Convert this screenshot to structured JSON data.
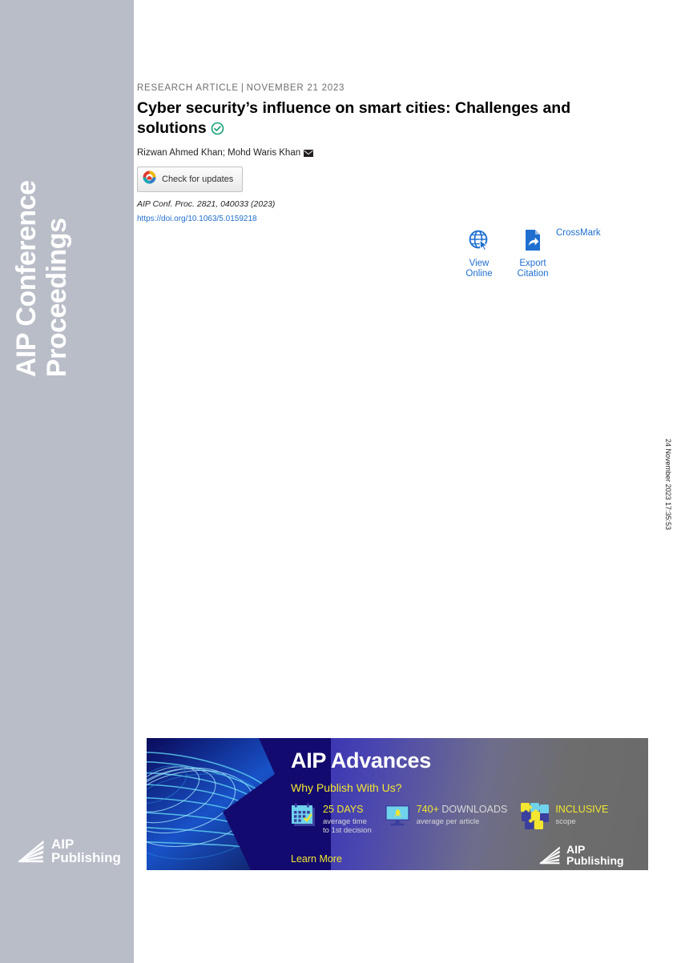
{
  "sidebar": {
    "journal_name": "AIP Conference\nProceedings",
    "publisher_logo": {
      "icon": "aip-fan-logo-icon",
      "line1": "AIP",
      "line2": "Publishing"
    },
    "background_color": "#b9bdc8"
  },
  "margin": {
    "timestamp": "24 November 2023 17:35:53"
  },
  "article": {
    "kicker": {
      "type": "RESEARCH ARTICLE",
      "separator": "|",
      "date": "NOVEMBER 21 2023"
    },
    "title": "Cyber security’s influence on smart cities: Challenges and solutions",
    "open_access_icon": "circle-check-icon",
    "authors": "Rizwan Ahmed Khan; Mohd Waris Khan",
    "corresponding_author_icon": "envelope-icon",
    "crossmark_badge": {
      "icon": "crossmark-logo-icon",
      "label": "Check for updates"
    },
    "citation": "AIP Conf. Proc. 2821, 040033 (2023)",
    "doi_url": "https://doi.org/10.1063/5.0159218",
    "link_color": "#1f6fd0"
  },
  "actions": {
    "items": [
      {
        "icon": "globe-cursor-icon",
        "label": "View\nOnline"
      },
      {
        "icon": "document-share-icon",
        "label": "Export\nCitation"
      }
    ],
    "crossmark_label": "CrossMark"
  },
  "banner": {
    "title": "AIP Advances",
    "subtitle": "Why Publish With Us?",
    "stats": [
      {
        "icon": "calendar-check-icon",
        "headline": "25 DAYS",
        "sub": "average time\nto 1st decision"
      },
      {
        "icon": "monitor-rocket-icon",
        "headline_strong": "740+",
        "headline_dim": "DOWNLOADS",
        "sub": "average per article"
      },
      {
        "icon": "puzzle-pieces-icon",
        "headline": "INCLUSIVE",
        "sub": "scope"
      }
    ],
    "cta": "Learn More",
    "logo": {
      "icon": "aip-fan-logo-icon",
      "line1": "AIP",
      "line2": "Publishing"
    },
    "accent_color": "#f2e630",
    "art_icon": "fiber-optic-swirl-graphic"
  }
}
